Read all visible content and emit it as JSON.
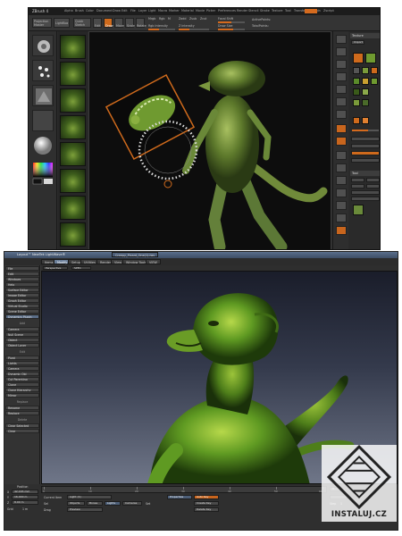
{
  "zbrush": {
    "title": "ZBrush 4",
    "menu": [
      "Alpha",
      "Brush",
      "Color",
      "Document",
      "Draw",
      "Edit",
      "File",
      "Layer",
      "Light",
      "Macro",
      "Marker",
      "Material",
      "Movie",
      "Picker",
      "Preferences",
      "Render",
      "Stencil",
      "Stroke",
      "Texture",
      "Tool",
      "Transform",
      "Zplugin",
      "Zscript"
    ],
    "toolbar": {
      "projection_label": "Projection Master",
      "lightbox_label": "LightBox",
      "quicksketch_label": "Quick Sketch",
      "edit_label": "Edit",
      "draw_label": "Draw",
      "move_label": "Move",
      "scale_label": "Scale",
      "rotate_label": "Rotate",
      "mrgb_label": "Mrgb",
      "rgb_label": "Rgb",
      "m_label": "M",
      "rgb_intensity_label": "Rgb Intensity",
      "zadd_label": "Zadd",
      "zsub_label": "Zsub",
      "zcut_label": "Zcut",
      "z_intensity_label": "Z Intensity",
      "focal_shift_label": "Focal Shift",
      "draw_size_label": "Draw Size",
      "active_points_label": "ActivePoints:",
      "total_points_label": "TotalPoints:"
    },
    "palette": {
      "texture_header": "Texture",
      "import_label": "Import",
      "tool_header": "Tool"
    }
  },
  "layout": {
    "title": "Layout™ NewTek LightWave®",
    "scene_tab": "Creepy_Picard_One(1).lws",
    "tabs": [
      "Items",
      "Modify",
      "Setup",
      "Utilities",
      "Render",
      "View",
      "Window Tools",
      "VIEW"
    ],
    "menu_items": [
      "File",
      "Edit",
      "Windows",
      "Help",
      "Surface Editor",
      "Image Editor",
      "Graph Editor",
      "Virtual Studio",
      "Scene Editor",
      "Dynamics Plugin"
    ],
    "add_header": "Add",
    "add_items": [
      "Camera",
      "Null Scene",
      "Object",
      "Object Layer"
    ],
    "edit_header": "Edit",
    "edit_items": [
      "Pivot",
      "Lights",
      "Camera",
      "Dynamic Obj",
      "Cut Parenting",
      "Clone",
      "Clone Hierarchy",
      "Mirror"
    ],
    "replace_header": "Replace",
    "replace_items": [
      "Rename",
      "Replace"
    ],
    "delete_header": "Delete",
    "delete_items": [
      "Clear Selected",
      "Clear"
    ],
    "viewport": {
      "view_mode": "Perspective",
      "shading": "SPEC"
    },
    "bottom": {
      "position_label": "Position",
      "x_label": "X",
      "y_label": "Y",
      "z_label": "Z",
      "x_value": "42.165 mm",
      "y_value": "16.400 m",
      "z_value": "8.00 m",
      "grid_label": "Grid",
      "grid_value": "1 m",
      "current_item_label": "Current Item",
      "current_item_value": "Light (1)",
      "objects_label": "Objects",
      "bones_label": "Bones",
      "lights_label": "Lights",
      "cameras_label": "Cameras",
      "set_label": "Set",
      "properties_label": "Properties",
      "auto_key_label": "Auto Key",
      "create_key_label": "Create Key",
      "delete_key_label": "Delete Key",
      "preview_label": "Preview",
      "step_label": "Step",
      "step_value": "1",
      "frame_label": "0",
      "timeline_ticks": [
        "0",
        "10",
        "20",
        "30",
        "40",
        "50",
        "60"
      ],
      "sel_label": "Sel",
      "drag_label": "Drag"
    }
  },
  "watermark": {
    "text": "INSTALUJ.CZ"
  }
}
